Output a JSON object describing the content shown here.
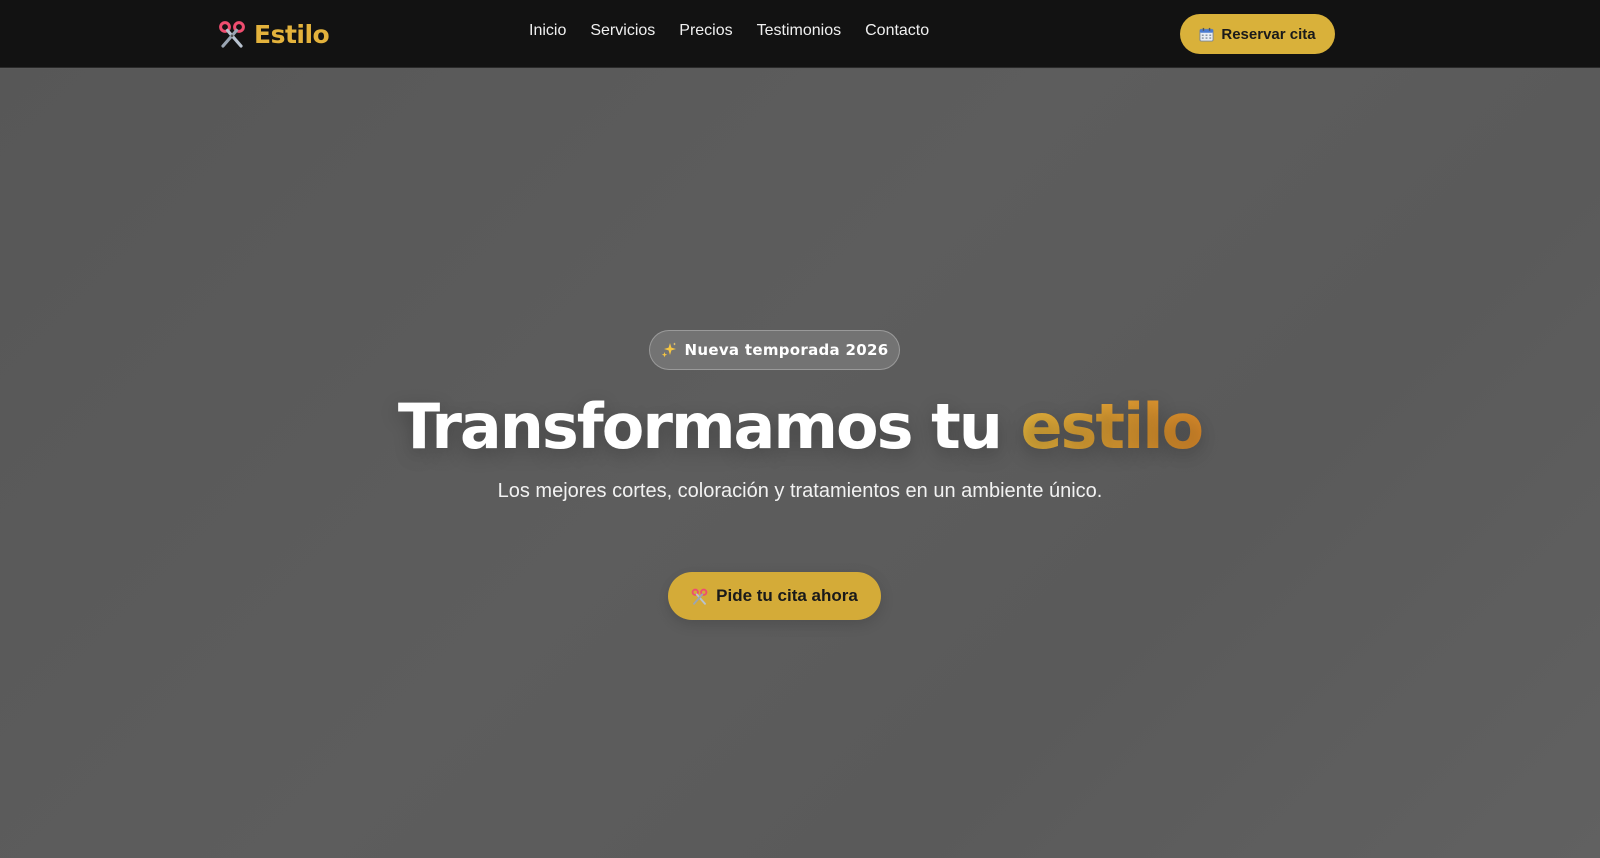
{
  "brand": {
    "name": "Estilo",
    "logo_icon": "scissors-icon",
    "color": "#e3b23c"
  },
  "nav": {
    "links": [
      {
        "label": "Inicio"
      },
      {
        "label": "Servicios"
      },
      {
        "label": "Precios"
      },
      {
        "label": "Testimonios"
      },
      {
        "label": "Contacto"
      }
    ],
    "reserve_button": {
      "icon": "calendar-icon",
      "label": "Reservar cita"
    }
  },
  "hero": {
    "badge": {
      "icon": "sparkles-icon",
      "label": "Nueva temporada 2026"
    },
    "title": {
      "main": "Transformamos tu ",
      "accent": "estilo"
    },
    "subtitle": "Los mejores cortes, coloración y tratamientos en un ambiente único.",
    "cta_button": {
      "icon": "scissors-icon",
      "label": "Pide tu cita ahora"
    }
  },
  "colors": {
    "accent": "#d9b13a",
    "accent_gradient_end": "#d8892a",
    "navbar_bg": "#121212",
    "hero_bg": "#5a5a5a"
  }
}
